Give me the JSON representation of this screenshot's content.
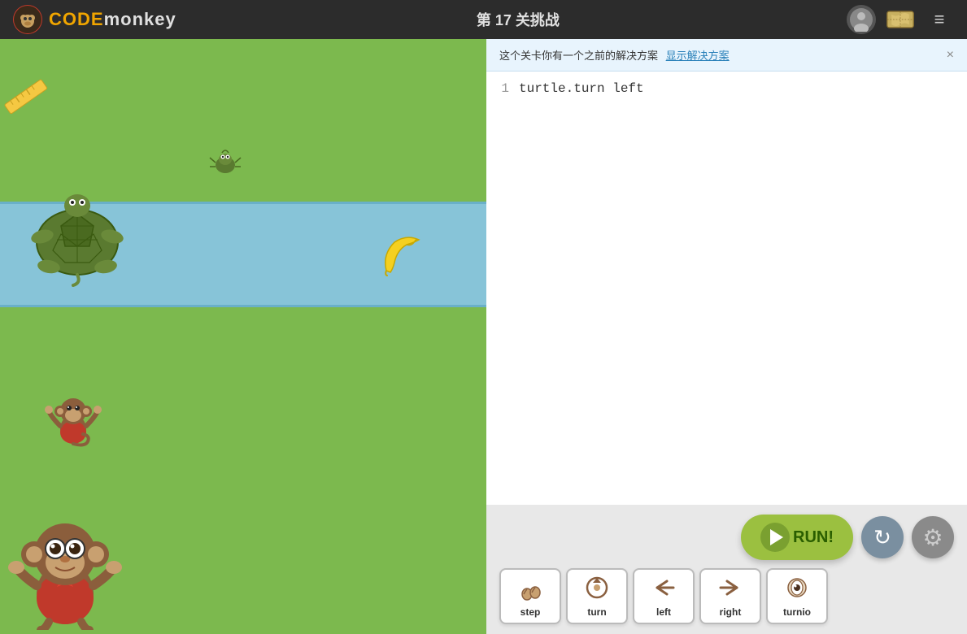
{
  "header": {
    "logo_monkey": "🐵",
    "logo_code": "CODE",
    "logo_monkey_text": "monkey",
    "challenge_label": "第 17 关挑战",
    "profile_icon": "👤",
    "map_icon": "🗺",
    "menu_icon": "≡"
  },
  "notification": {
    "message": "这个关卡你有一个之前的解决方案",
    "link_text": "显示解决方案",
    "close": "×"
  },
  "code_editor": {
    "lines": [
      {
        "number": "1",
        "content": "turtle.turn left"
      }
    ]
  },
  "controls": {
    "run_label": "RUN!",
    "reset_icon": "↻",
    "settings_icon": "⚙"
  },
  "code_blocks": [
    {
      "id": "step",
      "label": "step",
      "icon": "👣"
    },
    {
      "id": "turn",
      "label": "turn",
      "icon": "🔄"
    },
    {
      "id": "left",
      "label": "left",
      "icon": "↩"
    },
    {
      "id": "right",
      "label": "right",
      "icon": "↪"
    },
    {
      "id": "turnio",
      "label": "turnio",
      "icon": "👁"
    }
  ]
}
